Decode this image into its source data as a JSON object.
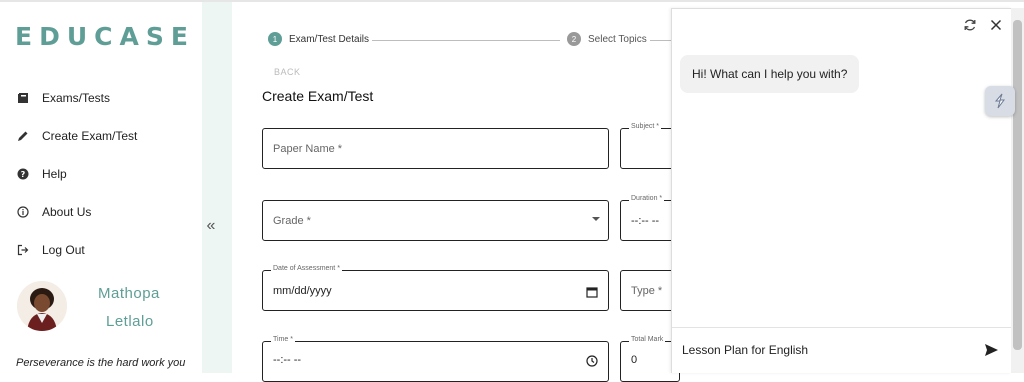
{
  "app": {
    "logo": "EDUCASE"
  },
  "sidebar": {
    "items": [
      {
        "label": "Exams/Tests",
        "icon": "book-icon"
      },
      {
        "label": "Create Exam/Test",
        "icon": "pencil-icon"
      },
      {
        "label": "Help",
        "icon": "help-icon"
      },
      {
        "label": "About Us",
        "icon": "info-icon"
      },
      {
        "label": "Log Out",
        "icon": "logout-icon"
      }
    ],
    "user": {
      "first_name": "Mathopa",
      "last_name": "Letlalo"
    },
    "quote": "Perseverance is the hard work you",
    "collapse_label": "«"
  },
  "stepper": {
    "steps": [
      {
        "number": "1",
        "label": "Exam/Test Details"
      },
      {
        "number": "2",
        "label": "Select Topics"
      }
    ]
  },
  "form": {
    "back_label": "BACK",
    "title": "Create Exam/Test",
    "paper_name": {
      "placeholder": "Paper Name *"
    },
    "subject": {
      "label": "Subject *"
    },
    "grade": {
      "placeholder": "Grade *"
    },
    "duration": {
      "label": "Duration *",
      "value": "--:-- --"
    },
    "date": {
      "label": "Date of Assessment *",
      "value": "mm/dd/yyyy"
    },
    "type": {
      "placeholder": "Type *"
    },
    "time": {
      "label": "Time *",
      "value": "--:-- --"
    },
    "total_marks": {
      "label": "Total Mark",
      "value": "0"
    }
  },
  "chat": {
    "greeting": "Hi! What can I help you with?",
    "input_value": "Lesson Plan for English"
  },
  "colors": {
    "brand": "#5f9e96",
    "rail": "#eef6f4"
  }
}
